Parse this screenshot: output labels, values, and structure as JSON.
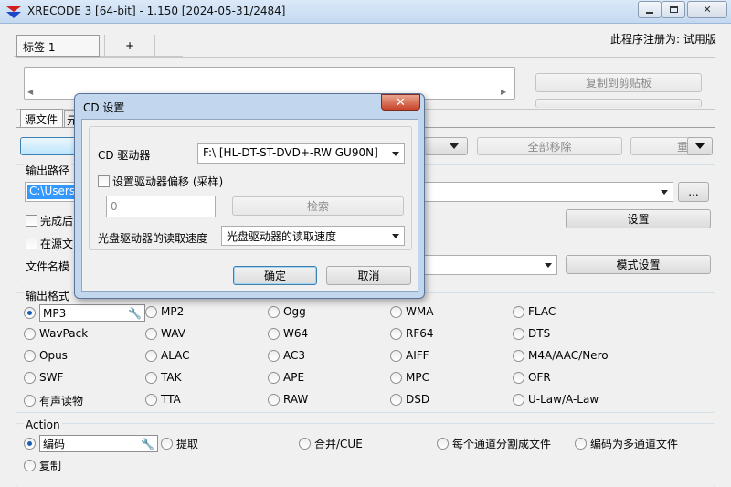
{
  "window": {
    "title": "XRECODE 3 [64-bit] - 1.150 [2024-05-31/2484]",
    "min_glyph": "▭",
    "max_glyph": "▢",
    "close_glyph": "✕"
  },
  "tabs": {
    "active_label": "标签 1",
    "add_label": "+"
  },
  "registration": "此程序注册为: 试用版",
  "copy_button": "复制到剪贴板",
  "source_tabs": [
    "源文件",
    "元"
  ],
  "toolbar": {
    "remove_all": "全部移除",
    "partial_right": "重"
  },
  "output_path": {
    "heading": "输出路径",
    "value": "C:\\Users\\",
    "browse": "...",
    "settings": "设置",
    "after_done_label": "完成后",
    "in_source_label": "在源文",
    "filename_mode_label": "文件名模",
    "mode_settings": "模式设置"
  },
  "output_format": {
    "heading": "输出格式",
    "formats": [
      [
        "MP3",
        "MP2",
        "Ogg",
        "WMA",
        "FLAC"
      ],
      [
        "WavPack",
        "WAV",
        "W64",
        "RF64",
        "DTS"
      ],
      [
        "Opus",
        "ALAC",
        "AC3",
        "AIFF",
        "M4A/AAC/Nero"
      ],
      [
        "SWF",
        "TAK",
        "APE",
        "MPC",
        "OFR"
      ],
      [
        "有声读物",
        "TTA",
        "RAW",
        "DSD",
        "U-Law/A-Law"
      ]
    ],
    "selected": "MP3"
  },
  "action": {
    "heading": "Action",
    "options": [
      "编码",
      "提取",
      "合并/CUE",
      "每个通道分割成文件",
      "编码为多通道文件"
    ],
    "copy": "复制",
    "selected": "编码"
  },
  "dialog": {
    "title": "CD 设置",
    "close_glyph": "✕",
    "drive_label": "CD 驱动器",
    "drive_value": "F:\\ [HL-DT-ST-DVD+-RW GU90N]",
    "offset_checkbox": "设置驱动器偏移 (采样)",
    "offset_value": "0",
    "detect_button": "检索",
    "speed_label": "光盘驱动器的读取速度",
    "speed_value": "光盘驱动器的读取速度",
    "ok": "确定",
    "cancel": "取消"
  },
  "colors": {
    "accent": "#1a5fb4",
    "path_highlight": "#3399ff",
    "dialog_frame": "#c2d6ee",
    "close_red": "#c7442a"
  },
  "icons": {
    "app": "xrecode-logo-icon",
    "wrench": "wrench-icon"
  }
}
